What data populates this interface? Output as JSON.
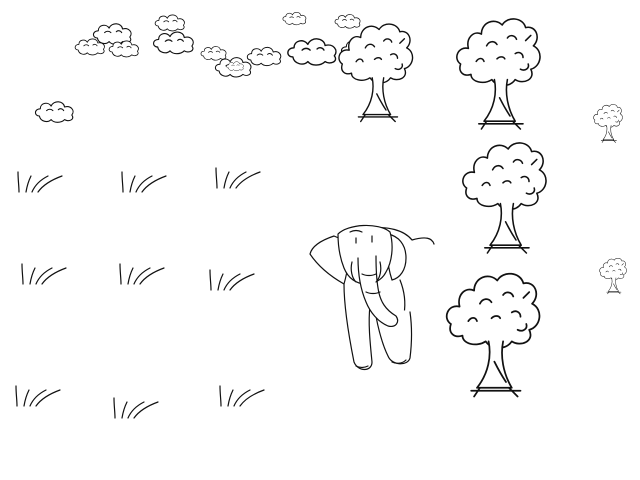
{
  "scene": {
    "background_color": "#ffffff",
    "ink_color": "#111111",
    "style": "hand-drawn line sketch",
    "sprites": {
      "clouds": [
        "cloud-icon",
        "cloud-icon",
        "cloud-icon",
        "cloud-icon",
        "cloud-icon",
        "cloud-icon",
        "cloud-icon",
        "cloud-icon",
        "cloud-icon",
        "cloud-icon",
        "cloud-icon",
        "cloud-icon",
        "cloud-icon",
        "cloud-icon"
      ],
      "trees": [
        "tree-icon",
        "tree-icon",
        "tree-icon",
        "tree-icon",
        "tree-icon",
        "tree-icon"
      ],
      "grass": [
        "grass-tuft-icon",
        "grass-tuft-icon",
        "grass-tuft-icon",
        "grass-tuft-icon",
        "grass-tuft-icon",
        "grass-tuft-icon",
        "grass-tuft-icon",
        "grass-tuft-icon",
        "grass-tuft-icon"
      ],
      "player": "elephant-icon"
    }
  }
}
